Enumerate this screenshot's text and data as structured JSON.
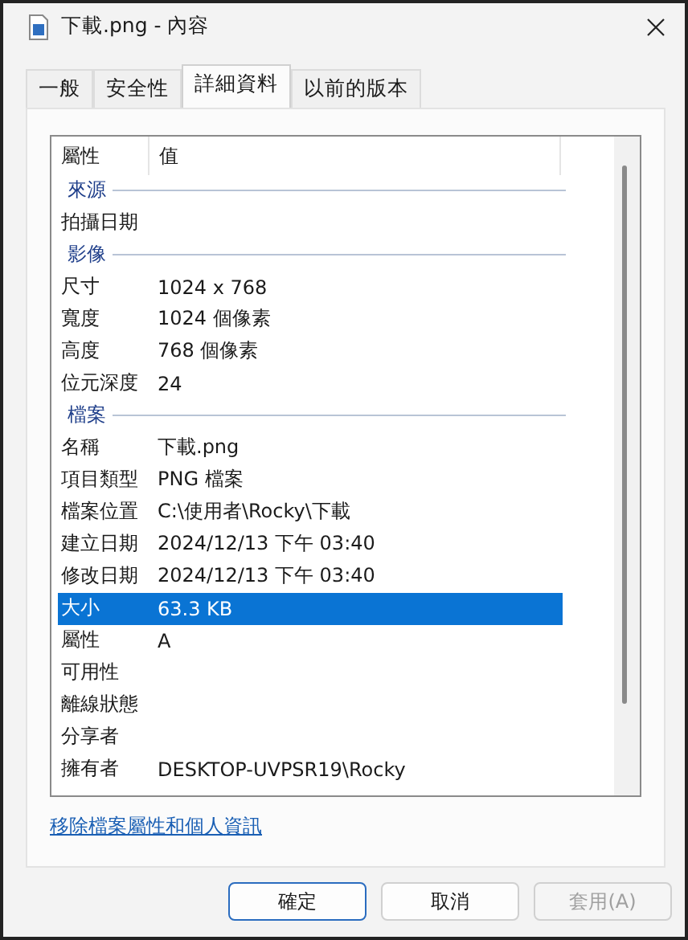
{
  "window": {
    "title": "下載.png - 內容"
  },
  "tabs": [
    {
      "label": "一般",
      "selected": false
    },
    {
      "label": "安全性",
      "selected": false
    },
    {
      "label": "詳細資料",
      "selected": true
    },
    {
      "label": "以前的版本",
      "selected": false
    }
  ],
  "list": {
    "columns": [
      "屬性",
      "值"
    ],
    "groups": [
      {
        "label": "來源",
        "rows": [
          {
            "property": "拍攝日期",
            "selected": false
          }
        ]
      },
      {
        "label": "影像",
        "rows": [
          {
            "property": "尺寸",
            "value": "1024 x 768",
            "selected": false
          },
          {
            "property": "寬度",
            "value": "1024 個像素",
            "selected": false
          },
          {
            "property": "高度",
            "value": "768 個像素",
            "selected": false
          },
          {
            "property": "位元深度",
            "value": "24",
            "selected": false
          }
        ]
      },
      {
        "label": "檔案",
        "rows": [
          {
            "property": "名稱",
            "value": "下載.png",
            "selected": false
          },
          {
            "property": "項目類型",
            "value": "PNG 檔案",
            "selected": false
          },
          {
            "property": "檔案位置",
            "value": "C:\\使用者\\Rocky\\下載",
            "selected": false
          },
          {
            "property": "建立日期",
            "value": "2024/12/13 下午 03:40",
            "selected": false
          },
          {
            "property": "修改日期",
            "value": "2024/12/13 下午 03:40",
            "selected": false
          },
          {
            "property": "大小",
            "value": "63.3 KB",
            "selected": true
          },
          {
            "property": "屬性",
            "value": "A",
            "selected": false
          },
          {
            "property": "可用性",
            "selected": false
          },
          {
            "property": "離線狀態",
            "selected": false
          },
          {
            "property": "分享者",
            "selected": false
          },
          {
            "property": "擁有者",
            "value": "DESKTOP-UVPSR19\\Rocky",
            "selected": false
          }
        ]
      }
    ]
  },
  "link": "移除檔案屬性和個人資訊",
  "buttons": [
    {
      "label": "確定",
      "kind": "default",
      "disabled": false
    },
    {
      "label": "取消",
      "kind": "normal",
      "disabled": false
    },
    {
      "label": "套用(A)",
      "kind": "normal",
      "disabled": true
    }
  ]
}
